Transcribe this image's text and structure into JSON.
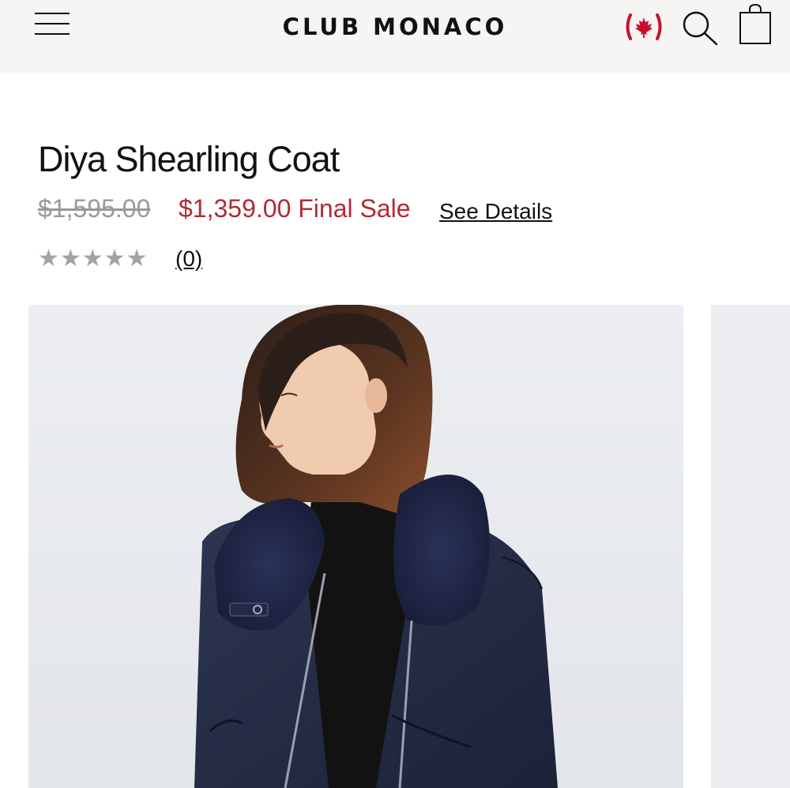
{
  "header": {
    "brand": "CLUB MONACO",
    "icons": [
      "menu-icon",
      "canada-flag-icon",
      "search-icon",
      "shopping-bag-icon"
    ],
    "colors": {
      "background": "#f6f5f3",
      "flag_red": "#c8102e"
    }
  },
  "product": {
    "title": "Diya Shearling Coat",
    "original_price": "$1,595.00",
    "sale_price": "$1,359.00 Final Sale",
    "details_link": "See Details",
    "rating_stars": "★★★★★",
    "rating_value": 0,
    "review_count": "(0)",
    "colors": {
      "sale": "#b22a36",
      "old_price": "#9a9a9a",
      "stars": "#a3a3a3"
    }
  },
  "gallery": {
    "main_image": "model-wearing-navy-shearling-coat",
    "next_image": "next-product-image-preview"
  }
}
